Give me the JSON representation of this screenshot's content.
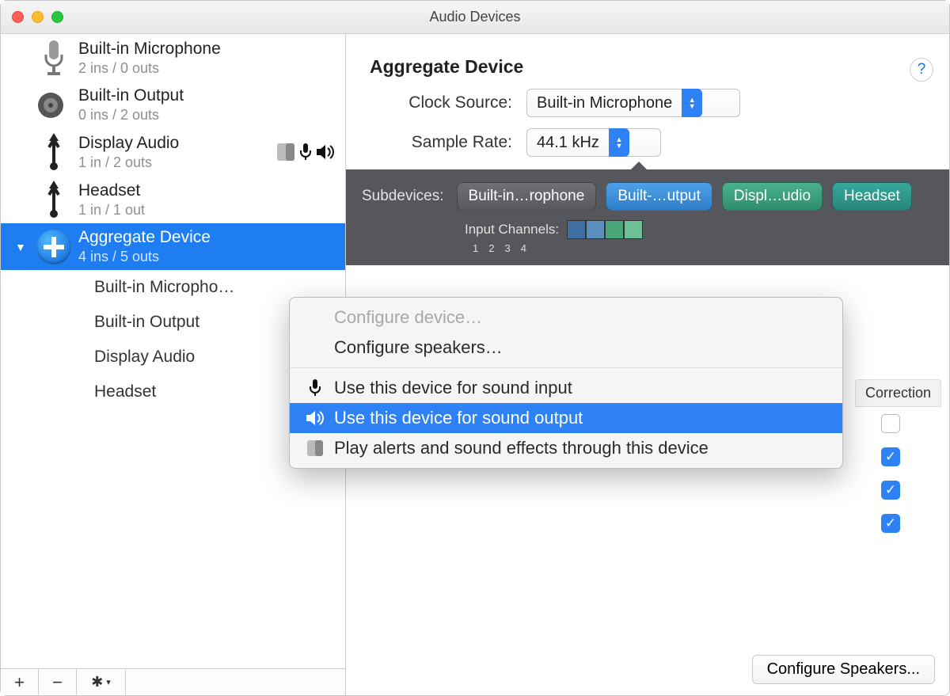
{
  "window": {
    "title": "Audio Devices"
  },
  "sidebar": {
    "devices": [
      {
        "name": "Built-in Microphone",
        "io": "2 ins / 0 outs",
        "icon": "microphone"
      },
      {
        "name": "Built-in Output",
        "io": "0 ins / 2 outs",
        "icon": "speaker"
      },
      {
        "name": "Display Audio",
        "io": "1 in / 2 outs",
        "icon": "usb",
        "badges": [
          "finder",
          "mic",
          "sound"
        ]
      },
      {
        "name": "Headset",
        "io": "1 in / 1 out",
        "icon": "usb"
      },
      {
        "name": "Aggregate Device",
        "io": "4 ins / 5 outs",
        "icon": "aggregate",
        "selected": true,
        "expanded": true
      }
    ],
    "subdevices": [
      "Built-in Micropho…",
      "Built-in Output",
      "Display Audio",
      "Headset"
    ],
    "footer": {
      "add": "+",
      "remove": "−",
      "actions": "gear"
    }
  },
  "panel": {
    "title": "Aggregate Device",
    "clock_source_label": "Clock Source:",
    "clock_source_value": "Built-in Microphone",
    "sample_rate_label": "Sample Rate:",
    "sample_rate_value": "44.1 kHz",
    "help": "?"
  },
  "band": {
    "label": "Subdevices:",
    "pills": [
      {
        "text": "Built-in…rophone",
        "tone": "gray"
      },
      {
        "text": "Built-…utput",
        "tone": "blue"
      },
      {
        "text": "Displ…udio",
        "tone": "green"
      },
      {
        "text": "Headset",
        "tone": "teal"
      }
    ],
    "input_channels_label": "Input Channels:",
    "channel_numbers": [
      "1",
      "2",
      "3",
      "4"
    ]
  },
  "table": {
    "columns_visible": [
      "Correction"
    ],
    "correction_checks": [
      false,
      true,
      true,
      true
    ]
  },
  "context_menu": {
    "items": [
      {
        "label": "Configure device…",
        "disabled": true
      },
      {
        "label": "Configure speakers…",
        "disabled": false
      },
      {
        "separator": true
      },
      {
        "label": "Use this device for sound input",
        "icon": "mic"
      },
      {
        "label": "Use this device for sound output",
        "icon": "sound",
        "highlight": true
      },
      {
        "label": "Play alerts and sound effects through this device",
        "icon": "finder"
      }
    ]
  },
  "footer_button": "Configure Speakers..."
}
